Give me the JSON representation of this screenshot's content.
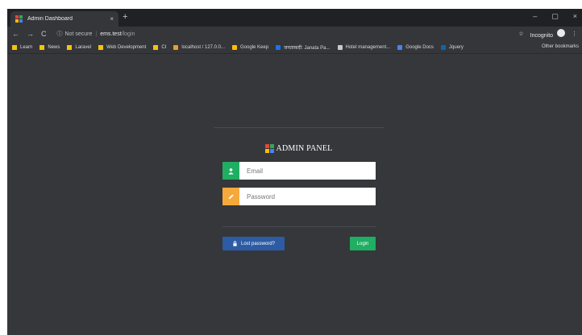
{
  "browser": {
    "tab_title": "Admin Dashboard",
    "tab_close": "×",
    "new_tab": "+",
    "window_controls": {
      "minimize": "–",
      "restore": "▢",
      "close": "×"
    },
    "nav": {
      "back": "←",
      "forward": "→",
      "reload": "C"
    },
    "address": {
      "security_label": "Not secure",
      "separator": "|",
      "host": "ems.test",
      "path": "/login"
    },
    "incognito_label": "Incognito",
    "star": "☆",
    "menu": "⋮"
  },
  "bookmarks": [
    {
      "label": "Learn",
      "icon": "folder-icon",
      "color": "#f4c20d"
    },
    {
      "label": "News",
      "icon": "folder-icon",
      "color": "#f4c20d"
    },
    {
      "label": "Laravel",
      "icon": "folder-icon",
      "color": "#f4c20d"
    },
    {
      "label": "Web Development",
      "icon": "folder-icon",
      "color": "#f4c20d"
    },
    {
      "label": "CI",
      "icon": "folder-icon",
      "color": "#f4c20d"
    },
    {
      "label": "localhost / 127.0.0...",
      "icon": "phpmyadmin-icon",
      "color": "#e8a02a"
    },
    {
      "label": "Google Keep",
      "icon": "keep-icon",
      "color": "#fbbc04"
    },
    {
      "label": "जनताकदी: Janata Pa...",
      "icon": "globe-icon",
      "color": "#1a73e8"
    },
    {
      "label": "Hotel management...",
      "icon": "image-icon",
      "color": "#c9c9c9"
    },
    {
      "label": "Google Docs",
      "icon": "docs-icon",
      "color": "#4285f4"
    },
    {
      "label": "Jquery",
      "icon": "jquery-icon",
      "color": "#0769ad"
    }
  ],
  "other_bookmarks": "Other bookmarks",
  "login": {
    "brand": "ADMIN PANEL",
    "email_placeholder": "Email",
    "password_placeholder": "Password",
    "lost_password": "Lost password?",
    "login_button": "Login"
  },
  "colors": {
    "page_bg": "#35373b",
    "email_addon": "#1fae62",
    "password_addon": "#f4a93a",
    "lost_btn": "#2d5ba4",
    "login_btn": "#1fae62"
  }
}
